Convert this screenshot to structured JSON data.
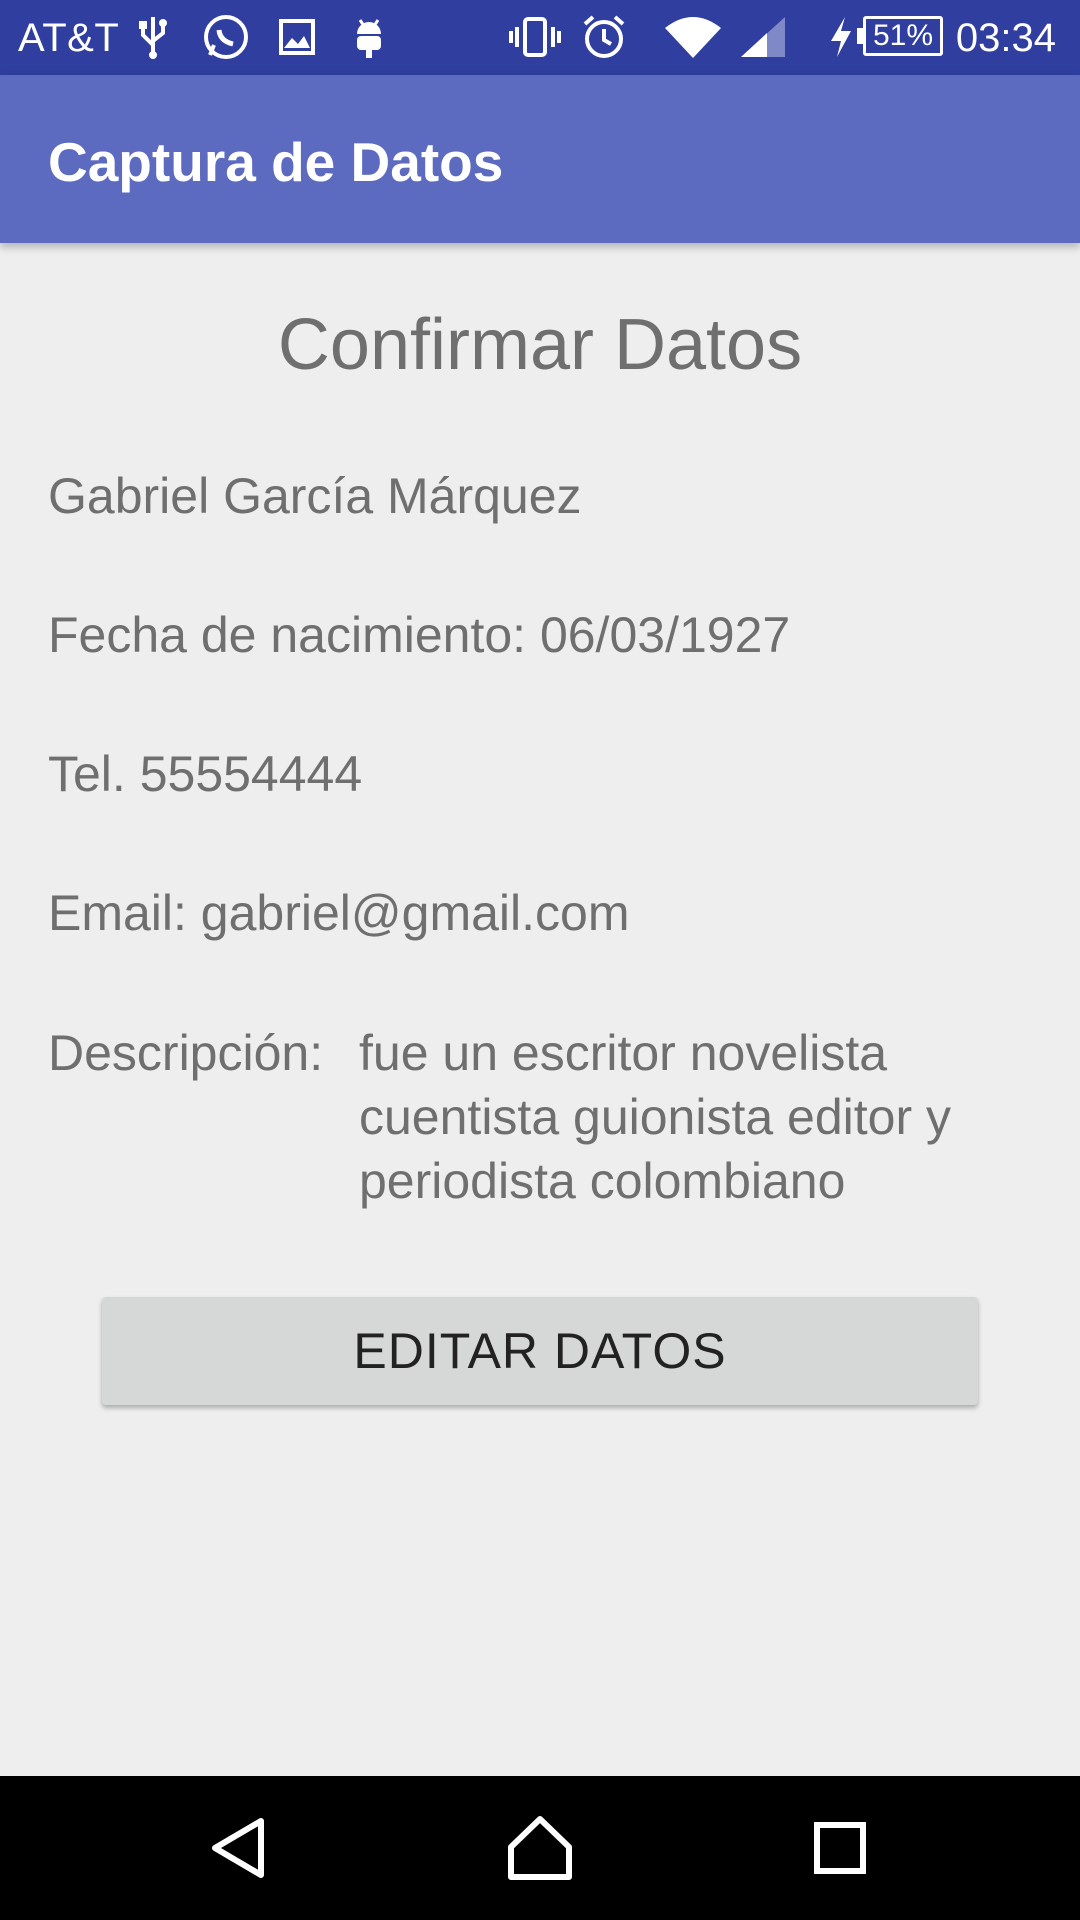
{
  "status_bar": {
    "carrier": "AT&T",
    "battery": "51%",
    "time": "03:34",
    "icons": [
      "usb-icon",
      "whatsapp-icon",
      "image-icon",
      "android-icon",
      "vibrate-icon",
      "alarm-icon",
      "wifi-icon",
      "signal-icon",
      "charging-icon",
      "battery-icon"
    ]
  },
  "app_bar": {
    "title": "Captura de Datos",
    "color": "#5c6bc0"
  },
  "content": {
    "heading": "Confirmar Datos",
    "name": "Gabriel García Márquez",
    "birth_date": "Fecha de nacimiento: 06/03/1927",
    "phone": "Tel. 55554444",
    "email": "Email: gabriel@gmail.com",
    "description_label": "Descripción:",
    "description_value": "fue un escritor novelista cuentista guionista editor y periodista colombiano"
  },
  "actions": {
    "edit_label": "EDITAR DATOS"
  },
  "nav_bar": {
    "icons": [
      "back-icon",
      "home-icon",
      "recents-icon"
    ]
  },
  "colors": {
    "status_bar": "#2f3e9f",
    "background": "#eeeeee",
    "text": "#6f6f6f",
    "button": "#d6d7d7"
  }
}
